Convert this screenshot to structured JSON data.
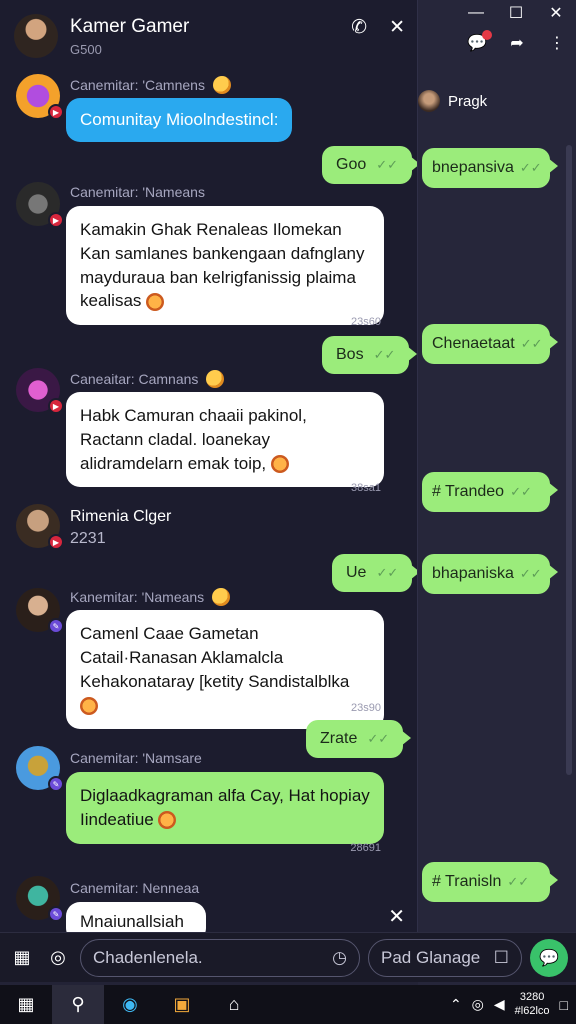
{
  "window": {
    "minimize": "—",
    "maximize": "☐",
    "close": "✕"
  },
  "header": {
    "title": "Kamer Gamer",
    "subtitle": "G500"
  },
  "background_window": {
    "contact_name": "Pragk",
    "bubbles": [
      {
        "text": "bnepansiva"
      },
      {
        "text": "Chenaetaat"
      },
      {
        "text": "# Trandeo"
      },
      {
        "text": "bhapaniska"
      },
      {
        "text": "# Tranisln"
      }
    ]
  },
  "messages": [
    {
      "sender": "Canemitar: 'Camnens",
      "text": "Comunitay Mioolndestincl:",
      "style": "blue"
    },
    {
      "out_text": "Goo"
    },
    {
      "sender": "Canemitar: 'Nameans",
      "text": "Kamakin Ghak Renaleas Ilomekan Kan samlanes bankengaan dafnglany mayduraua ban kelrigfanissig plaima kealisas",
      "time": "23s60"
    },
    {
      "out_text": "Bos"
    },
    {
      "sender": "Caneaitar: Camnans",
      "text": "Habk Camuran chaaii pakinol, Ractann cladal. loanekay alidramdelarn emak toip,",
      "time": "38sa1"
    },
    {
      "sys_name": "Rimenia Clger",
      "sys_num": "2231"
    },
    {
      "out_text": "Ue"
    },
    {
      "sender": "Kanemitar: 'Nameans",
      "text": "Camenl Caae Gametan Catail·Ranasan Aklamalcla Kehakonataray [ketity Sandistalblka",
      "time": "23s90"
    },
    {
      "out_text": "Zrate"
    },
    {
      "sender": "Canemitar: 'Namsare",
      "text": "Diglaadkagraman alfa Cay, Hat hopiay Iindeatiue",
      "time": "28691",
      "style": "green"
    },
    {
      "sender": "Canemitar: Nenneaa",
      "text": "Mnaiunallsiah"
    }
  ],
  "compose": {
    "placeholder": "Chadenlenela.",
    "secondary": "Pad Glanage"
  },
  "taskbar": {
    "time": "3280",
    "date": "#l62lco"
  },
  "colors": {
    "accent_green": "#9bec7b",
    "accent_blue": "#2aa9ef",
    "send": "#39c26a",
    "badge": "#d7263d"
  }
}
